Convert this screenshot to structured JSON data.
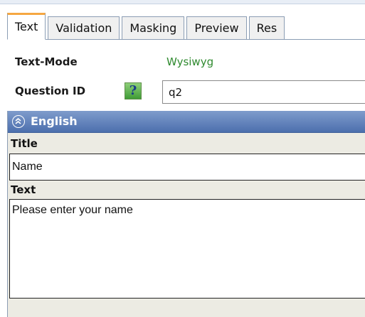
{
  "tabs": [
    {
      "label": "Text",
      "active": true
    },
    {
      "label": "Validation",
      "active": false
    },
    {
      "label": "Masking",
      "active": false
    },
    {
      "label": "Preview",
      "active": false
    },
    {
      "label": "Res",
      "active": false
    }
  ],
  "form": {
    "text_mode_label": "Text-Mode",
    "text_mode_value": "Wysiwyg",
    "question_id_label": "Question ID",
    "question_id_value": "q2",
    "help_icon_glyph": "?"
  },
  "language_panel": {
    "title": "English",
    "icon": "collapse-up-icon",
    "fields": {
      "title_label": "Title",
      "title_value": "Name",
      "text_label": "Text",
      "text_value": "Please enter your name"
    }
  },
  "colors": {
    "active_tab_accent": "#f5a742",
    "panel_header": "#5b7dba",
    "mode_value": "#2f8a2f"
  }
}
